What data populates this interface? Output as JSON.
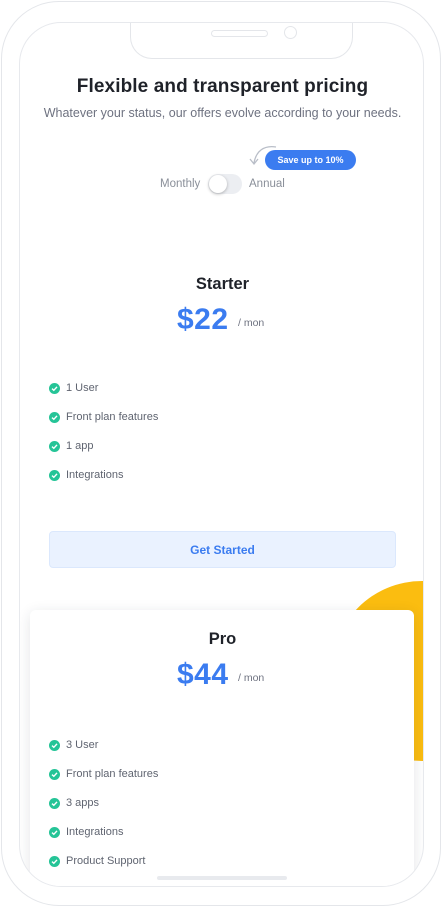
{
  "header": {
    "title": "Flexible and transparent pricing",
    "subtitle": "Whatever your status, our offers evolve according to your needs."
  },
  "billing": {
    "badge": "Save up to 10%",
    "monthly_label": "Monthly",
    "annual_label": "Annual",
    "annual_selected": false
  },
  "plans": [
    {
      "name": "Starter",
      "price": "$22",
      "period": "/ mon",
      "features": [
        "1 User",
        "Front plan features",
        "1 app",
        "Integrations"
      ],
      "cta": "Get Started"
    },
    {
      "name": "Pro",
      "price": "$44",
      "period": "/ mon",
      "features": [
        "3 User",
        "Front plan features",
        "3 apps",
        "Integrations",
        "Product Support"
      ]
    }
  ],
  "colors": {
    "accent": "#3b7cf0",
    "check": "#25c497",
    "highlight": "#fbbd10"
  }
}
